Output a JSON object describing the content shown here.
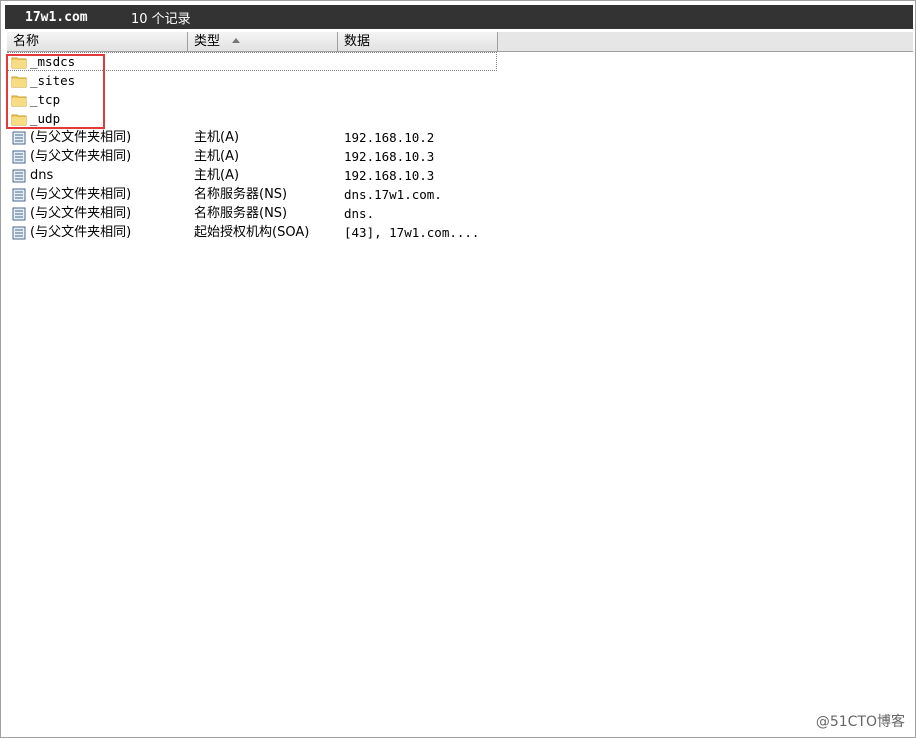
{
  "title_bar": {
    "zone": "17w1.com",
    "count": "10 个记录"
  },
  "columns": {
    "name": "名称",
    "type": "类型",
    "data": "数据"
  },
  "folders": [
    {
      "name": "_msdcs",
      "icon": "folder-icon"
    },
    {
      "name": "_sites",
      "icon": "folder-icon"
    },
    {
      "name": "_tcp",
      "icon": "folder-icon"
    },
    {
      "name": "_udp",
      "icon": "folder-icon"
    }
  ],
  "records": [
    {
      "name": "(与父文件夹相同)",
      "type": "主机(A)",
      "data": "192.168.10.2",
      "icon": "record-icon"
    },
    {
      "name": "(与父文件夹相同)",
      "type": "主机(A)",
      "data": "192.168.10.3",
      "icon": "record-icon"
    },
    {
      "name": "dns",
      "type": "主机(A)",
      "data": "192.168.10.3",
      "icon": "record-icon"
    },
    {
      "name": "(与父文件夹相同)",
      "type": "名称服务器(NS)",
      "data": "dns.17w1.com.",
      "icon": "record-icon"
    },
    {
      "name": "(与父文件夹相同)",
      "type": "名称服务器(NS)",
      "data": "dns.",
      "icon": "record-icon"
    },
    {
      "name": "(与父文件夹相同)",
      "type": "起始授权机构(SOA)",
      "data": "[43], 17w1.com....",
      "icon": "record-icon"
    }
  ],
  "watermark": "@51CTO博客",
  "colors": {
    "highlight": "#e23a3a",
    "titlebar_bg": "#333333",
    "folder": "#f2cc5f"
  }
}
